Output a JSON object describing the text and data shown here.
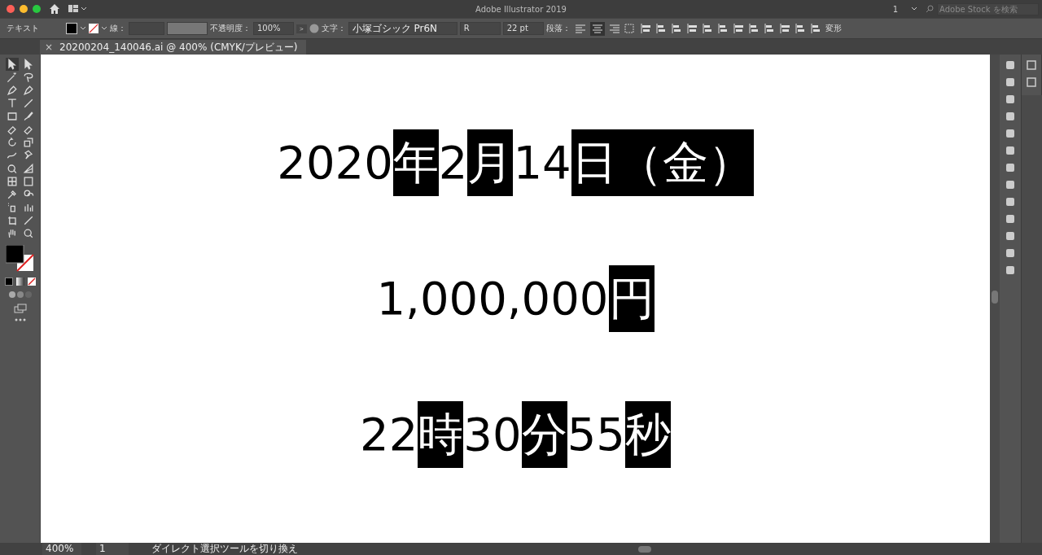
{
  "window": {
    "title": "Adobe Illustrator 2019",
    "workspace": "1",
    "search": {
      "placeholder": "Adobe Stock を検索"
    }
  },
  "control_bar": {
    "mode": "テキスト",
    "stroke_label": "線：",
    "opacity_label": "不透明度：",
    "opacity": "100%",
    "opacity_more": ">",
    "font_label": "文字：",
    "font": "小塚ゴシック Pr6N",
    "style": "R",
    "size": "22 pt",
    "paragraph_label": "段落：",
    "paragraph_align": [
      {
        "kind": "left",
        "selected": false
      },
      {
        "kind": "center",
        "selected": true
      },
      {
        "kind": "right",
        "selected": false
      }
    ],
    "transform": "変形"
  },
  "tabs": [
    {
      "close": "×",
      "label": "20200204_140046.ai @ 400% (CMYK/プレビュー)",
      "selected": true
    }
  ],
  "artboard": {
    "lines": [
      {
        "segments": [
          {
            "text": "2020",
            "selected": false
          },
          {
            "text": "年",
            "selected": true
          },
          {
            "text": "2",
            "selected": false
          },
          {
            "text": "月",
            "selected": true
          },
          {
            "text": "14",
            "selected": false
          },
          {
            "text": "日（金）",
            "selected": true
          }
        ]
      },
      {
        "segments": [
          {
            "text": "1,000,000",
            "selected": false
          },
          {
            "text": "円",
            "selected": true
          }
        ]
      },
      {
        "segments": [
          {
            "text": "22",
            "selected": false
          },
          {
            "text": "時",
            "selected": true
          },
          {
            "text": "30",
            "selected": false
          },
          {
            "text": "分",
            "selected": true
          },
          {
            "text": "55",
            "selected": false
          },
          {
            "text": "秒",
            "selected": true
          }
        ]
      }
    ]
  },
  "status_bar": {
    "zoom": "400%",
    "artboard": "1",
    "tool": "ダイレクト選択ツールを切り換え"
  }
}
